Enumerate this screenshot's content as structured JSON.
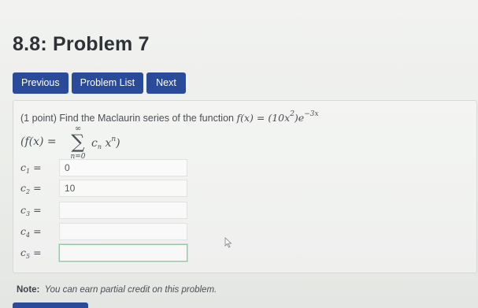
{
  "header": {
    "title": "8.8: Problem 7"
  },
  "nav": {
    "previous": "Previous",
    "problem_list": "Problem List",
    "next": "Next"
  },
  "problem": {
    "statement": "(1 point) Find the Maclaurin series of the function",
    "function_lhs": "f(x) =",
    "function_rhs": "(10x",
    "function_rhs_exp": "2",
    "function_rhs_tail": ")e",
    "function_exp": "−3x",
    "series_lhs": "(f(x) =",
    "sigma_upper": "∞",
    "sigma_symbol": "∑",
    "sigma_lower": "n=0",
    "series_term": "c",
    "series_term_sub": "n",
    "series_term_x": "x",
    "series_term_exp": "n",
    "series_close": ")"
  },
  "coefficients": [
    {
      "label": "c",
      "sub": "1",
      "eq": " =",
      "value": "0"
    },
    {
      "label": "c",
      "sub": "2",
      "eq": " =",
      "value": "10"
    },
    {
      "label": "c",
      "sub": "3",
      "eq": " =",
      "value": ""
    },
    {
      "label": "c",
      "sub": "4",
      "eq": " =",
      "value": ""
    },
    {
      "label": "c",
      "sub": "5",
      "eq": " =",
      "value": ""
    }
  ],
  "footer": {
    "note_label": "Note:",
    "note_text": "You can earn partial credit on this problem."
  },
  "colors": {
    "button_bg": "#2a4a9a",
    "focus_border": "#8fc9a8"
  }
}
